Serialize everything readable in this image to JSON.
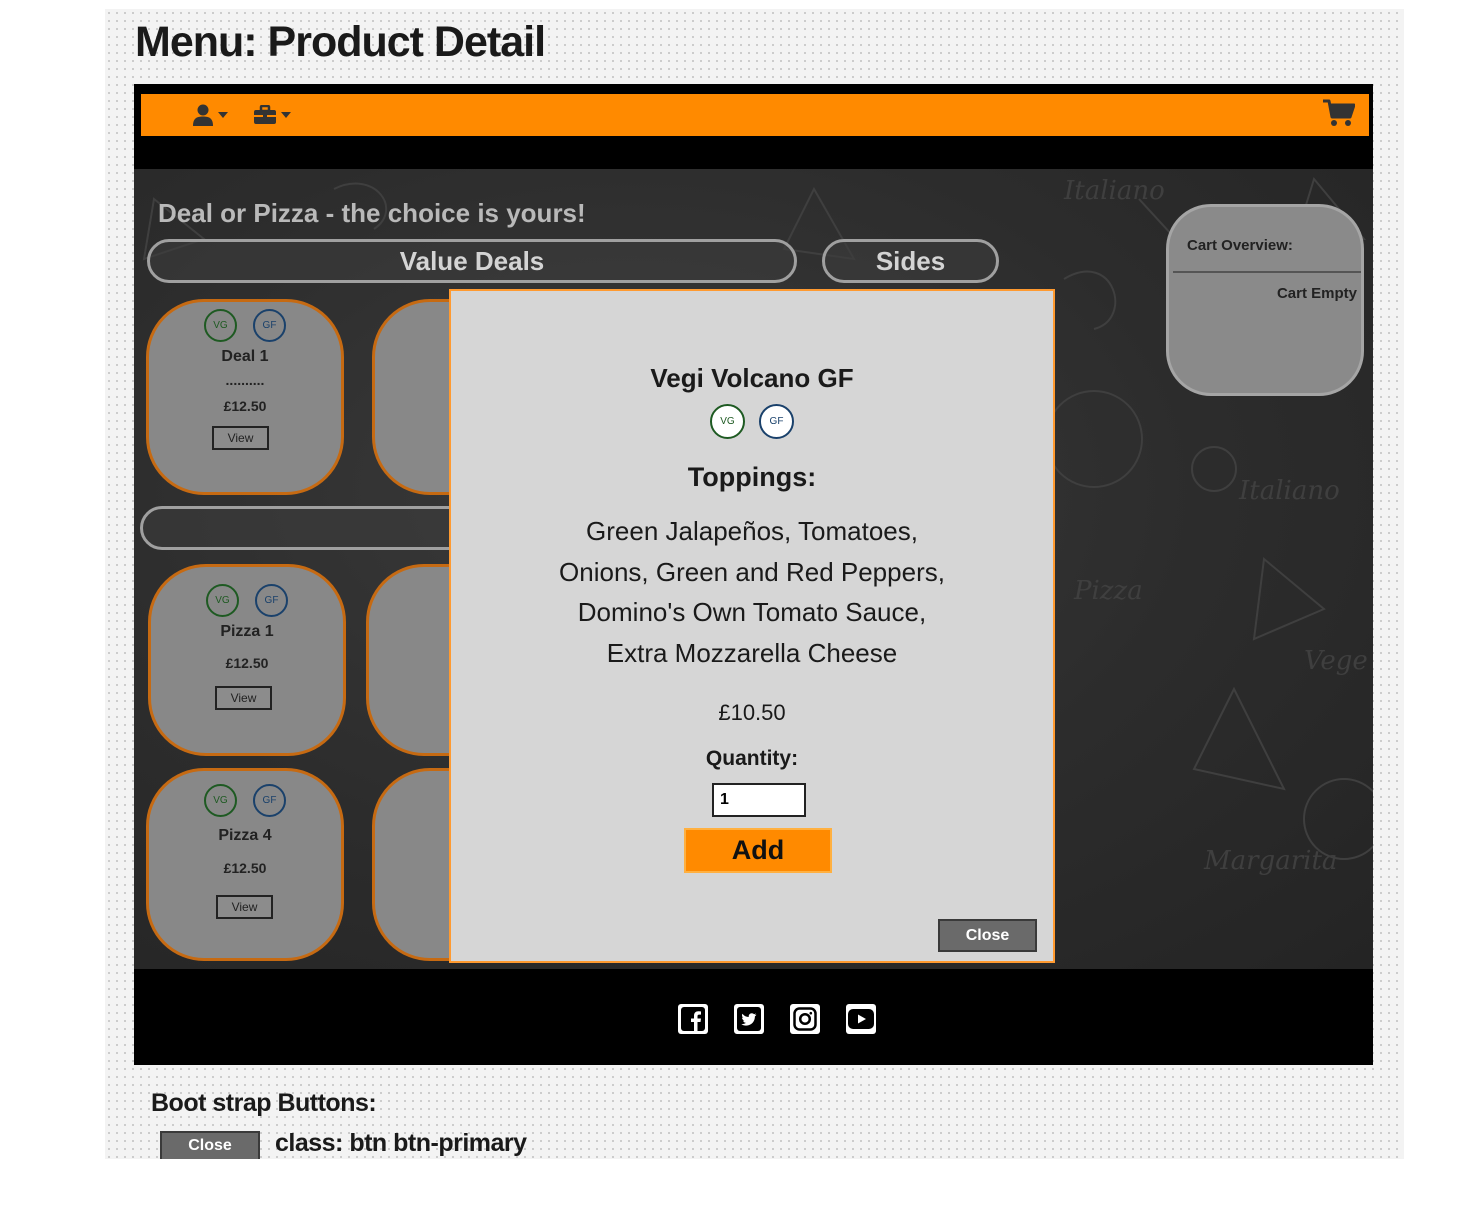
{
  "board": {
    "title": "Menu: Product Detail"
  },
  "navbar": {
    "icons": [
      "user-icon",
      "briefcase-icon",
      "shopping-cart-icon"
    ],
    "accent_color": "#ff8a00"
  },
  "menu": {
    "headline": "Deal or Pizza - the choice is yours!",
    "tabs": [
      {
        "label": "Value Deals"
      },
      {
        "label": "Sides"
      },
      {
        "label": ""
      }
    ],
    "badges": {
      "vg": "VG",
      "gf": "GF"
    },
    "cards": [
      {
        "name": "Deal 1",
        "dots": "..........",
        "price": "£12.50",
        "button": "View"
      },
      {
        "name": "Pizza 1",
        "price": "£12.50",
        "button": "View"
      },
      {
        "name": "Pizza 4",
        "price": "£12.50",
        "button": "View"
      }
    ]
  },
  "cart": {
    "title": "Cart Overview:",
    "status": "Cart Empty"
  },
  "modal": {
    "name": "Vegi Volcano GF",
    "badges": [
      "VG",
      "GF"
    ],
    "toppings_heading": "Toppings:",
    "toppings_lines": [
      "Green Jalapeños, Tomatoes,",
      "Onions, Green and Red Peppers,",
      "Domino's Own Tomato Sauce,",
      "Extra Mozzarella Cheese"
    ],
    "price": "£10.50",
    "quantity_label": "Quantity:",
    "quantity_value": "1",
    "add_label": "Add",
    "close_label": "Close"
  },
  "footer": {
    "social": [
      "facebook-icon",
      "twitter-icon",
      "instagram-icon",
      "youtube-icon"
    ]
  },
  "bootstrap": {
    "heading": "Boot strap Buttons:",
    "sample_button": "Close",
    "class_text": "class: btn btn-primary"
  }
}
